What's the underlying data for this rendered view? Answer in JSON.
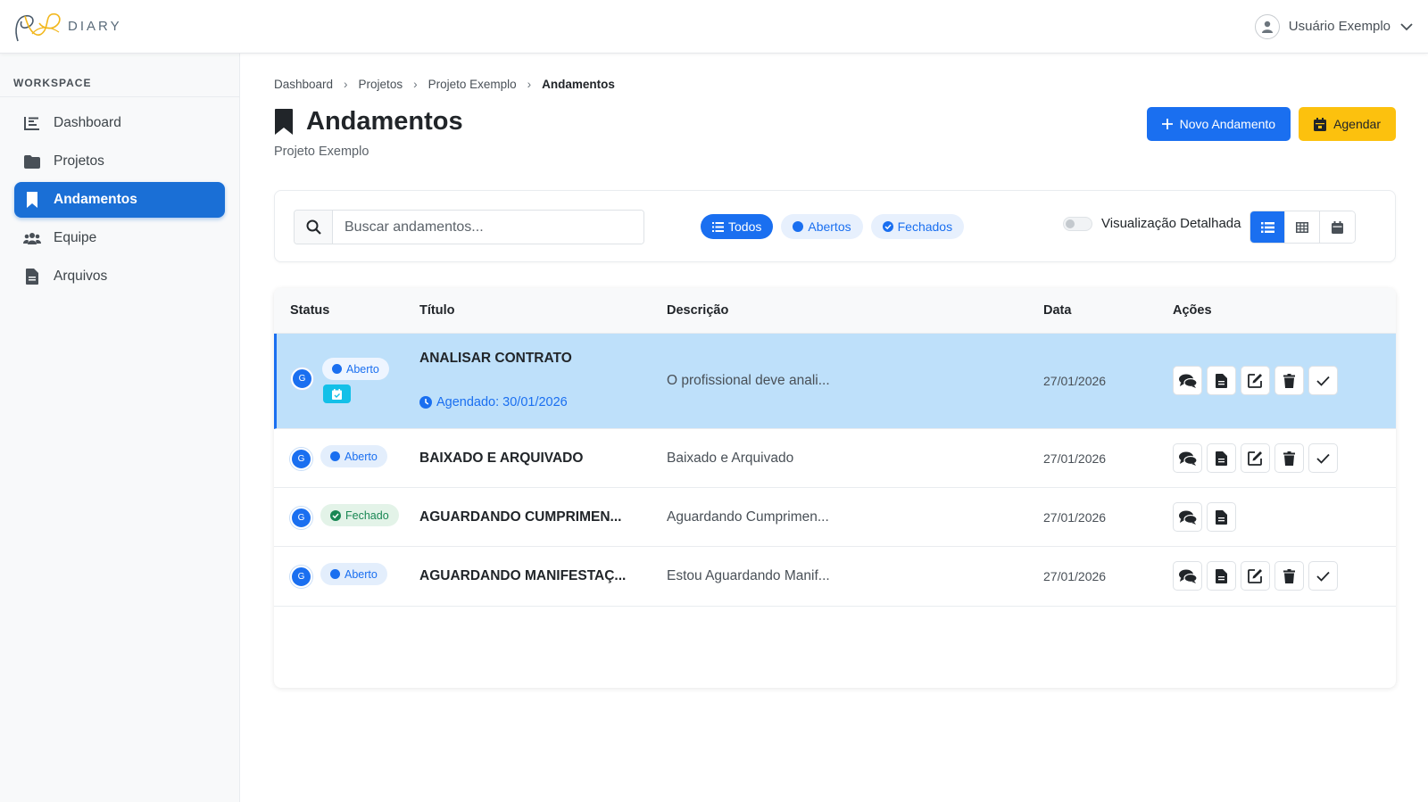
{
  "brand": {
    "name": "DIARY"
  },
  "user": {
    "name": "Usuário Exemplo"
  },
  "sidebar": {
    "section_label": "WORKSPACE",
    "items": [
      {
        "label": "Dashboard",
        "icon": "chart-icon",
        "active": false
      },
      {
        "label": "Projetos",
        "icon": "folder-icon",
        "active": false
      },
      {
        "label": "Andamentos",
        "icon": "bookmark-icon",
        "active": true
      },
      {
        "label": "Equipe",
        "icon": "users-icon",
        "active": false
      },
      {
        "label": "Arquivos",
        "icon": "file-icon",
        "active": false
      }
    ]
  },
  "breadcrumb": {
    "items": [
      "Dashboard",
      "Projetos",
      "Projeto Exemplo"
    ],
    "current": "Andamentos",
    "separator": "›"
  },
  "page": {
    "title": "Andamentos",
    "subtitle": "Projeto Exemplo"
  },
  "header_actions": {
    "new_label": "Novo Andamento",
    "schedule_label": "Agendar"
  },
  "filters": {
    "search_placeholder": "Buscar andamentos...",
    "pills": [
      {
        "label": "Todos",
        "active": true
      },
      {
        "label": "Abertos",
        "active": false
      },
      {
        "label": "Fechados",
        "active": false
      }
    ],
    "toggle_label": "Visualização Detalhada",
    "views": [
      "list-icon",
      "grid-icon",
      "calendar-icon"
    ]
  },
  "table": {
    "headers": {
      "status": "Status",
      "title": "Título",
      "description": "Descrição",
      "date": "Data",
      "actions": "Ações"
    },
    "rows": [
      {
        "avatar": "G",
        "status": "Aberto",
        "title": "ANALISAR CONTRATO",
        "scheduled": "Agendado: 30/01/2026",
        "description": "O profissional deve anali...",
        "date": "27/01/2026"
      },
      {
        "avatar": "G",
        "status": "Aberto",
        "title": "BAIXADO E ARQUIVADO",
        "description": "Baixado e Arquivado",
        "date": "27/01/2026"
      },
      {
        "avatar": "G",
        "status": "Fechado",
        "title": "AGUARDANDO CUMPRIMEN...",
        "description": "Aguardando Cumprimen...",
        "date": "27/01/2026"
      },
      {
        "avatar": "G",
        "status": "Aberto",
        "title": "AGUARDANDO MANIFESTAÇ...",
        "description": "Estou Aguardando Manif...",
        "date": "27/01/2026"
      }
    ]
  },
  "colors": {
    "primary": "#1a6ff0",
    "warning": "#fcc10e",
    "success": "#198754",
    "selected_row": "#bee0fa",
    "info": "#13c0e8"
  }
}
